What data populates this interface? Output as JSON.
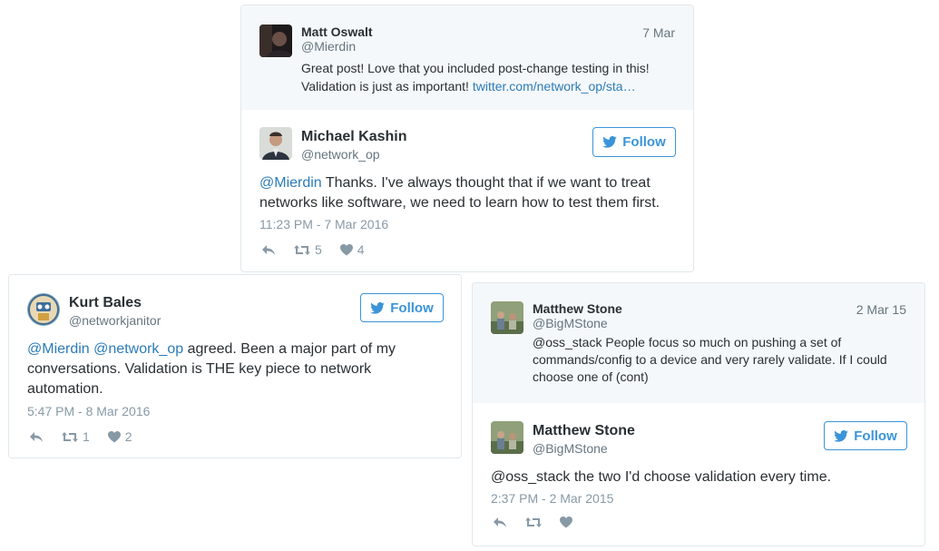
{
  "tweet1": {
    "parent": {
      "name": "Matt Oswalt",
      "handle": "@Mierdin",
      "date": "7 Mar",
      "text_line1": "Great post! Love that you included post-change testing in this!",
      "text_line2_plain": "Validation is just as important! ",
      "text_line2_link": "twitter.com/network_op/sta…"
    },
    "main": {
      "name": "Michael Kashin",
      "handle": "@network_op",
      "follow_label": "Follow",
      "mention": "@Mierdin",
      "text_line1_rest": " Thanks. I've always thought that if we want to treat",
      "text_line2": "networks like software, we need to learn how to test them first.",
      "timestamp": "11:23 PM - 7 Mar 2016",
      "retweets": "5",
      "likes": "4"
    }
  },
  "tweet2": {
    "name": "Kurt Bales",
    "handle": "@networkjanitor",
    "follow_label": "Follow",
    "mention1": "@Mierdin",
    "mention2": "@network_op",
    "text_line1_rest": " agreed. Been a major part of my",
    "text_line2": "conversations. Validation is THE key piece to network",
    "text_line3": "automation.",
    "timestamp": "5:47 PM - 8 Mar 2016",
    "retweets": "1",
    "likes": "2"
  },
  "tweet3": {
    "parent": {
      "name": "Matthew Stone",
      "handle": "@BigMStone",
      "date": "2 Mar 15",
      "text_line1": "@oss_stack People focus so much on pushing a set of",
      "text_line2": "commands/config to a device and very rarely validate. If I could",
      "text_line3": "choose one of (cont)"
    },
    "main": {
      "name": "Matthew Stone",
      "handle": "@BigMStone",
      "follow_label": "Follow",
      "text": "@oss_stack the two I'd choose validation every time.",
      "timestamp": "2:37 PM - 2 Mar 2015"
    }
  },
  "colors": {
    "link": "#2b7bb9",
    "follow": "#3b94d9",
    "meta": "#8899a6",
    "parent_bg": "#f5f8fa",
    "border": "#e1e8ed"
  }
}
